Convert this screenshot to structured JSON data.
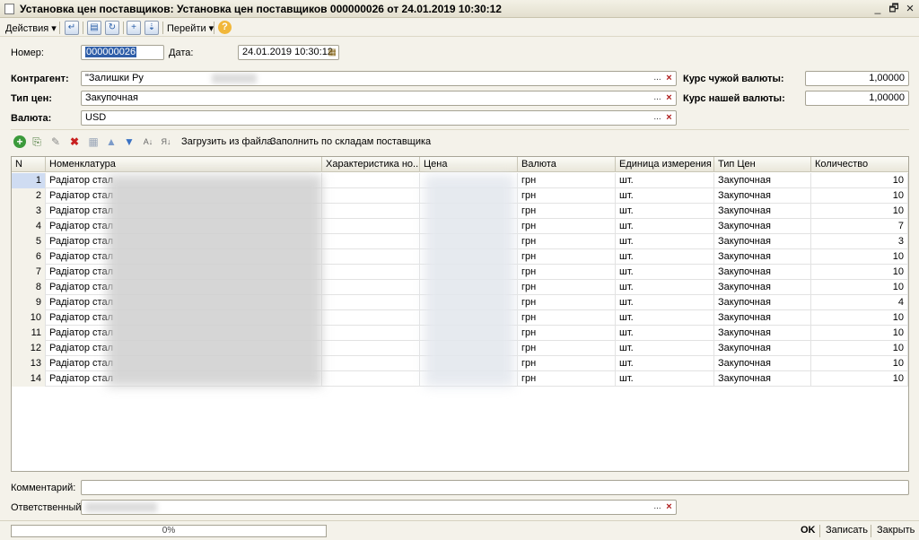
{
  "window": {
    "title": "Установка цен поставщиков: Установка цен поставщиков 000000026 от 24.01.2019 10:30:12",
    "minimize": "_",
    "restore": "🗗",
    "close": "×"
  },
  "toolbar": {
    "actions_label": "Действия",
    "goto_label": "Перейти",
    "dropdown_arrow": "▾",
    "help_label": "?"
  },
  "form": {
    "number_label": "Номер:",
    "number_value": "000000026",
    "date_label": "Дата:",
    "date_value": "24.01.2019 10:30:12",
    "counterparty_label": "Контрагент:",
    "counterparty_value": "\"Залишки Ру",
    "price_type_label": "Тип цен:",
    "price_type_value": "Закупочная",
    "currency_label": "Валюта:",
    "currency_value": "USD",
    "foreign_rate_label": "Курс чужой валюты:",
    "foreign_rate_value": "1,00000",
    "our_rate_label": "Курс нашей валюты:",
    "our_rate_value": "1,00000",
    "ellipsis": "...",
    "clear": "×"
  },
  "table_toolbar": {
    "load_file_label": "Загрузить из файла",
    "fill_label": "Заполнить по складам поставщика"
  },
  "table": {
    "columns": [
      "N",
      "Номенклатура",
      "Характеристика но...",
      "Цена",
      "Валюта",
      "Единица измерения",
      "Тип Цен",
      "Количество"
    ],
    "rows": [
      {
        "n": "1",
        "name": "Радіатор стал",
        "currency": "грн",
        "unit": "шт.",
        "price_type": "Закупочная",
        "qty": "10"
      },
      {
        "n": "2",
        "name": "Радіатор стал",
        "currency": "грн",
        "unit": "шт.",
        "price_type": "Закупочная",
        "qty": "10"
      },
      {
        "n": "3",
        "name": "Радіатор стал",
        "currency": "грн",
        "unit": "шт.",
        "price_type": "Закупочная",
        "qty": "10"
      },
      {
        "n": "4",
        "name": "Радіатор стал",
        "currency": "грн",
        "unit": "шт.",
        "price_type": "Закупочная",
        "qty": "7"
      },
      {
        "n": "5",
        "name": "Радіатор стал",
        "currency": "грн",
        "unit": "шт.",
        "price_type": "Закупочная",
        "qty": "3"
      },
      {
        "n": "6",
        "name": "Радіатор стал",
        "currency": "грн",
        "unit": "шт.",
        "price_type": "Закупочная",
        "qty": "10"
      },
      {
        "n": "7",
        "name": "Радіатор стал",
        "currency": "грн",
        "unit": "шт.",
        "price_type": "Закупочная",
        "qty": "10"
      },
      {
        "n": "8",
        "name": "Радіатор стал",
        "currency": "грн",
        "unit": "шт.",
        "price_type": "Закупочная",
        "qty": "10"
      },
      {
        "n": "9",
        "name": "Радіатор стал",
        "currency": "грн",
        "unit": "шт.",
        "price_type": "Закупочная",
        "qty": "4"
      },
      {
        "n": "10",
        "name": "Радіатор стал",
        "currency": "грн",
        "unit": "шт.",
        "price_type": "Закупочная",
        "qty": "10"
      },
      {
        "n": "11",
        "name": "Радіатор стал",
        "currency": "грн",
        "unit": "шт.",
        "price_type": "Закупочная",
        "qty": "10"
      },
      {
        "n": "12",
        "name": "Радіатор стал",
        "currency": "грн",
        "unit": "шт.",
        "price_type": "Закупочная",
        "qty": "10"
      },
      {
        "n": "13",
        "name": "Радіатор стал",
        "currency": "грн",
        "unit": "шт.",
        "price_type": "Закупочная",
        "qty": "10"
      },
      {
        "n": "14",
        "name": "Радіатор стал",
        "currency": "грн",
        "unit": "шт.",
        "price_type": "Закупочная",
        "qty": "10"
      }
    ]
  },
  "footer": {
    "comment_label": "Комментарий:",
    "comment_value": "",
    "responsible_label": "Ответственный:",
    "responsible_value": ""
  },
  "statusbar": {
    "progress_text": "0%",
    "progress_percent": 0,
    "ok_label": "OK",
    "save_label": "Записать",
    "close_label": "Закрыть"
  }
}
